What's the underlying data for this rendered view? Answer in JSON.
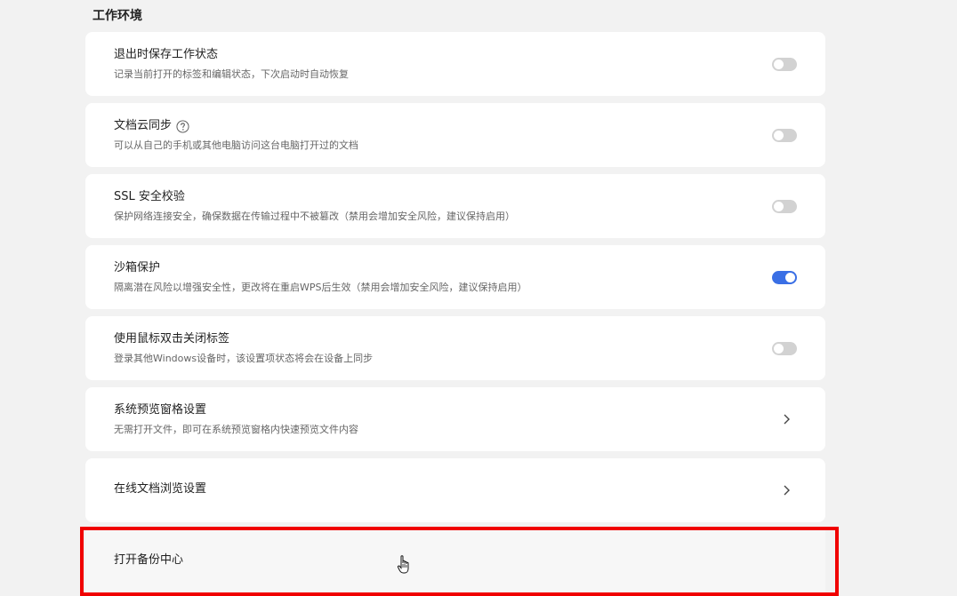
{
  "section": {
    "title": "工作环境"
  },
  "settings": [
    {
      "title": "退出时保存工作状态",
      "desc": "记录当前打开的标签和编辑状态，下次启动时自动恢复",
      "control": "toggle",
      "enabled": false
    },
    {
      "title": "文档云同步",
      "desc": "可以从自己的手机或其他电脑访问这台电脑打开过的文档",
      "control": "toggle",
      "enabled": false,
      "help_icon": "question-circle-icon"
    },
    {
      "title": "SSL 安全校验",
      "desc": "保护网络连接安全，确保数据在传输过程中不被篡改（禁用会增加安全风险，建议保持启用）",
      "control": "toggle",
      "enabled": false
    },
    {
      "title": "沙箱保护",
      "desc": "隔离潜在风险以增强安全性，更改将在重启WPS后生效（禁用会增加安全风险，建议保持启用）",
      "control": "toggle",
      "enabled": true
    },
    {
      "title": "使用鼠标双击关闭标签",
      "desc": "登录其他Windows设备时，该设置项状态将会在设备上同步",
      "control": "toggle",
      "enabled": false
    },
    {
      "title": "系统预览窗格设置",
      "desc": "无需打开文件，即可在系统预览窗格内快速预览文件内容",
      "control": "chevron",
      "icon": "chevron-right-icon"
    },
    {
      "title": "在线文档浏览设置",
      "control": "chevron",
      "icon": "chevron-right-icon"
    },
    {
      "title": "打开备份中心",
      "control": "none",
      "hovered": true
    }
  ],
  "colors": {
    "accent": "#3a6fe5",
    "highlight": "#f00000",
    "toggle_off": "#d2d2d2"
  }
}
